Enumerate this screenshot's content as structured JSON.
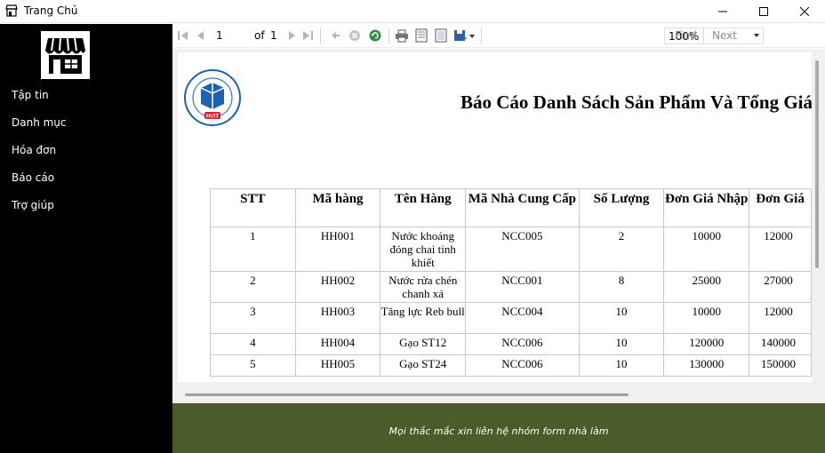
{
  "window": {
    "title": "Trang Chủ"
  },
  "sidebar": {
    "logo_icon": "store-icon",
    "items": [
      {
        "label": "Tập tin"
      },
      {
        "label": "Danh mục"
      },
      {
        "label": "Hóa đơn"
      },
      {
        "label": "Báo cáo"
      },
      {
        "label": "Trợ giúp"
      }
    ]
  },
  "toolbar": {
    "page_current": "1",
    "page_of": "of",
    "page_total": "1",
    "zoom": "100%",
    "find_label": "Find",
    "next_label": "Next"
  },
  "report": {
    "title": "Báo Cáo Danh Sách Sản Phẩm Và Tổng Giá",
    "logo_text": "HUIT",
    "columns": [
      "STT",
      "Mã hàng",
      "Tên Hàng",
      "Mã Nhà Cung Cấp",
      "Số Lượng",
      "Đơn Giá Nhập",
      "Đơn Giá"
    ],
    "rows": [
      [
        "1",
        "HH001",
        "Nước khoáng đóng chai tinh khiết",
        "NCC005",
        "2",
        "10000",
        "12000"
      ],
      [
        "2",
        "HH002",
        "Nước rửa chén chanh xả",
        "NCC001",
        "8",
        "25000",
        "27000"
      ],
      [
        "3",
        "HH003",
        "Tăng lực Reb bull",
        "NCC004",
        "10",
        "10000",
        "12000"
      ],
      [
        "4",
        "HH004",
        "Gạo ST12",
        "NCC006",
        "10",
        "120000",
        "140000"
      ],
      [
        "5",
        "HH005",
        "Gạo ST24",
        "NCC006",
        "10",
        "130000",
        "150000"
      ]
    ]
  },
  "footer": {
    "text": "Mọi thắc mắc xin liên hệ nhóm form nhà làm"
  },
  "colors": {
    "sidebar_bg": "#000000",
    "footer_bg": "#4a5c29",
    "logo_blue": "#1b63b0",
    "logo_red": "#d9232e"
  }
}
